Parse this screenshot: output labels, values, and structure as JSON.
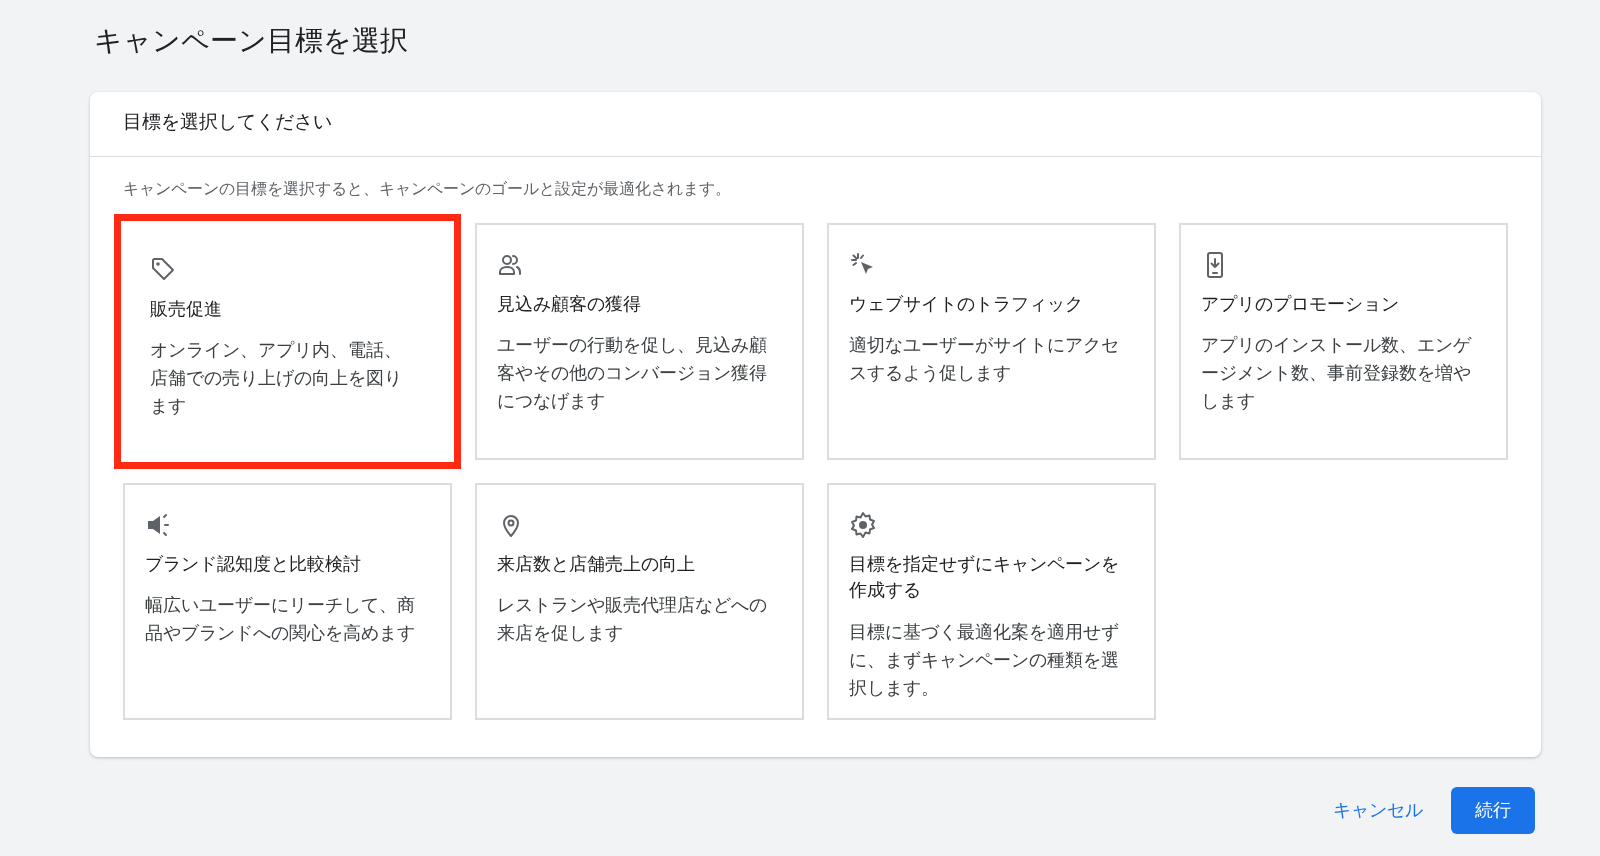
{
  "page_title": "キャンペーン目標を選択",
  "panel": {
    "heading": "目標を選択してください",
    "description": "キャンペーンの目標を選択すると、キャンペーンのゴールと設定が最適化されます。",
    "goals": [
      {
        "title": "販売促進",
        "description": "オンライン、アプリ内、電話、店舗での売り上げの向上を図ります",
        "selected": true
      },
      {
        "title": "見込み顧客の獲得",
        "description": "ユーザーの行動を促し、見込み顧客やその他のコンバージョン獲得につなげます",
        "selected": false
      },
      {
        "title": "ウェブサイトのトラフィック",
        "description": "適切なユーザーがサイトにアクセスするよう促します",
        "selected": false
      },
      {
        "title": "アプリのプロモーション",
        "description": "アプリのインストール数、エンゲージメント数、事前登録数を増やします",
        "selected": false
      },
      {
        "title": "ブランド認知度と比較検討",
        "description": "幅広いユーザーにリーチして、商品やブランドへの関心を高めます",
        "selected": false
      },
      {
        "title": "来店数と店舗売上の向上",
        "description": "レストランや販売代理店などへの来店を促します",
        "selected": false
      },
      {
        "title": "目標を指定せずにキャンペーンを作成する",
        "description": "目標に基づく最適化案を適用せずに、まずキャンペーンの種類を選択します。",
        "selected": false
      }
    ]
  },
  "footer": {
    "cancel": "キャンセル",
    "continue": "続行"
  }
}
